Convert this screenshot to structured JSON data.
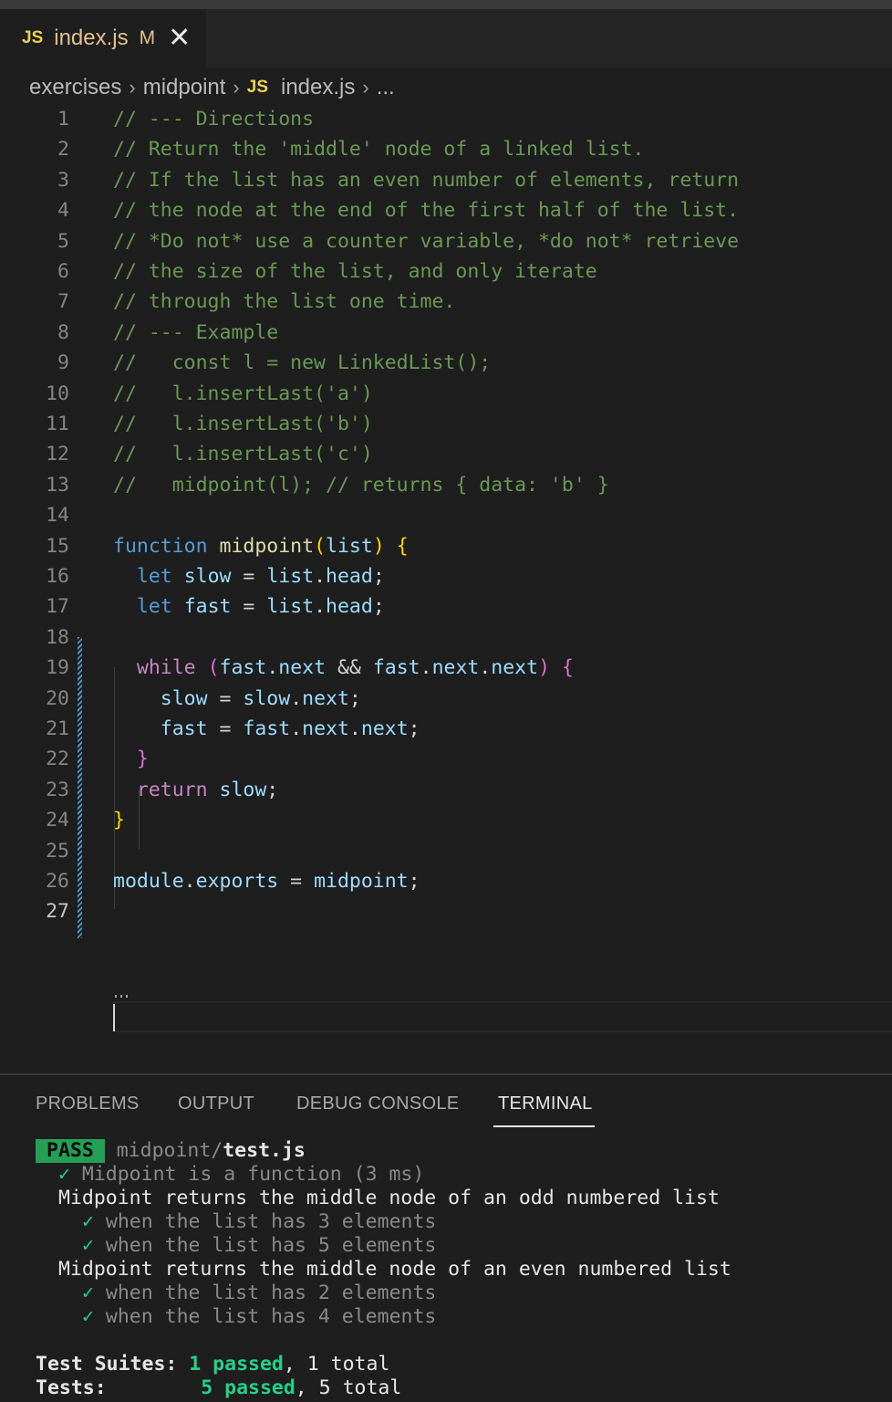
{
  "tab": {
    "badge": "JS",
    "title": "index.js",
    "modified": "M",
    "close": "✕"
  },
  "breadcrumb": {
    "items": [
      "exercises",
      "midpoint",
      "index.js",
      "..."
    ],
    "badge": "JS",
    "sep": "›"
  },
  "editor": {
    "lines": [
      {
        "n": "1",
        "text": "// --- Directions"
      },
      {
        "n": "2",
        "text": "// Return the 'middle' node of a linked list."
      },
      {
        "n": "3",
        "text": "// If the list has an even number of elements, return"
      },
      {
        "n": "4",
        "text": "// the node at the end of the first half of the list."
      },
      {
        "n": "5",
        "text": "// *Do not* use a counter variable, *do not* retrieve"
      },
      {
        "n": "6",
        "text": "// the size of the list, and only iterate"
      },
      {
        "n": "7",
        "text": "// through the list one time."
      },
      {
        "n": "8",
        "text": "// --- Example"
      },
      {
        "n": "9",
        "text": "//   const l = new LinkedList();"
      },
      {
        "n": "10",
        "text": "//   l.insertLast('a')"
      },
      {
        "n": "11",
        "text": "//   l.insertLast('b')"
      },
      {
        "n": "12",
        "text": "//   l.insertLast('c')"
      },
      {
        "n": "13",
        "text": "//   midpoint(l); // returns { data: 'b' }"
      },
      {
        "n": "14",
        "text": ""
      },
      {
        "n": "15",
        "tokens": [
          [
            "function",
            "c-keyword"
          ],
          [
            " ",
            "c-plain"
          ],
          [
            "midpoint",
            "c-func"
          ],
          [
            "(",
            "c-brace"
          ],
          [
            "list",
            "c-var"
          ],
          [
            ")",
            "c-brace"
          ],
          [
            " ",
            "c-plain"
          ],
          [
            "{",
            "c-brace"
          ]
        ]
      },
      {
        "n": "16",
        "tokens": [
          [
            "  ",
            "c-plain"
          ],
          [
            "let",
            "c-keyword"
          ],
          [
            " ",
            "c-plain"
          ],
          [
            "slow",
            "c-var"
          ],
          [
            " = ",
            "c-plain"
          ],
          [
            "list",
            "c-var"
          ],
          [
            ".",
            "c-plain"
          ],
          [
            "head",
            "c-var"
          ],
          [
            ";",
            "c-plain"
          ]
        ]
      },
      {
        "n": "17",
        "tokens": [
          [
            "  ",
            "c-plain"
          ],
          [
            "let",
            "c-keyword"
          ],
          [
            " ",
            "c-plain"
          ],
          [
            "fast",
            "c-var"
          ],
          [
            " = ",
            "c-plain"
          ],
          [
            "list",
            "c-var"
          ],
          [
            ".",
            "c-plain"
          ],
          [
            "head",
            "c-var"
          ],
          [
            ";",
            "c-plain"
          ]
        ]
      },
      {
        "n": "18",
        "text": ""
      },
      {
        "n": "19",
        "tokens": [
          [
            "  ",
            "c-plain"
          ],
          [
            "while",
            "c-control"
          ],
          [
            " ",
            "c-plain"
          ],
          [
            "(",
            "c-brace2"
          ],
          [
            "fast",
            "c-var"
          ],
          [
            ".",
            "c-plain"
          ],
          [
            "next",
            "c-var"
          ],
          [
            " && ",
            "c-plain"
          ],
          [
            "fast",
            "c-var"
          ],
          [
            ".",
            "c-plain"
          ],
          [
            "next",
            "c-var"
          ],
          [
            ".",
            "c-plain"
          ],
          [
            "next",
            "c-var"
          ],
          [
            ")",
            "c-brace2"
          ],
          [
            " ",
            "c-plain"
          ],
          [
            "{",
            "c-brace2"
          ]
        ]
      },
      {
        "n": "20",
        "tokens": [
          [
            "    ",
            "c-plain"
          ],
          [
            "slow",
            "c-var"
          ],
          [
            " = ",
            "c-plain"
          ],
          [
            "slow",
            "c-var"
          ],
          [
            ".",
            "c-plain"
          ],
          [
            "next",
            "c-var"
          ],
          [
            ";",
            "c-plain"
          ]
        ]
      },
      {
        "n": "21",
        "tokens": [
          [
            "    ",
            "c-plain"
          ],
          [
            "fast",
            "c-var"
          ],
          [
            " = ",
            "c-plain"
          ],
          [
            "fast",
            "c-var"
          ],
          [
            ".",
            "c-plain"
          ],
          [
            "next",
            "c-var"
          ],
          [
            ".",
            "c-plain"
          ],
          [
            "next",
            "c-var"
          ],
          [
            ";",
            "c-plain"
          ]
        ]
      },
      {
        "n": "22",
        "tokens": [
          [
            "  ",
            "c-plain"
          ],
          [
            "}",
            "c-brace2"
          ]
        ]
      },
      {
        "n": "23",
        "tokens": [
          [
            "  ",
            "c-plain"
          ],
          [
            "return",
            "c-control"
          ],
          [
            " ",
            "c-plain"
          ],
          [
            "slow",
            "c-var"
          ],
          [
            ";",
            "c-plain"
          ]
        ]
      },
      {
        "n": "24",
        "tokens": [
          [
            "}",
            "c-brace"
          ]
        ]
      },
      {
        "n": "25",
        "text": ""
      },
      {
        "n": "26",
        "tokens": [
          [
            "module",
            "c-var"
          ],
          [
            ".",
            "c-plain"
          ],
          [
            "exports",
            "c-var"
          ],
          [
            " = ",
            "c-plain"
          ],
          [
            "midpoint",
            "c-var"
          ],
          [
            ";",
            "c-plain"
          ]
        ]
      },
      {
        "n": "27",
        "text": ""
      }
    ]
  },
  "panel": {
    "tabs": [
      "PROBLEMS",
      "OUTPUT",
      "DEBUG CONSOLE",
      "TERMINAL"
    ],
    "active_tab": "TERMINAL"
  },
  "terminal": {
    "pass_label": "PASS",
    "file_dir": "midpoint/",
    "file_name": "test.js",
    "check": "✓",
    "test1": "Midpoint is a function (3 ms)",
    "group1": "Midpoint returns the middle node of an odd numbered list",
    "g1_t1": "when the list has 3 elements",
    "g1_t2": "when the list has 5 elements",
    "group2": "Midpoint returns the middle node of an even numbered list",
    "g2_t1": "when the list has 2 elements",
    "g2_t2": "when the list has 4 elements",
    "suites_label": "Test Suites:",
    "suites_passed": "1 passed",
    "suites_total": ", 1 total",
    "tests_label": "Tests:",
    "tests_passed": "5 passed",
    "tests_total": ", 5 total"
  }
}
